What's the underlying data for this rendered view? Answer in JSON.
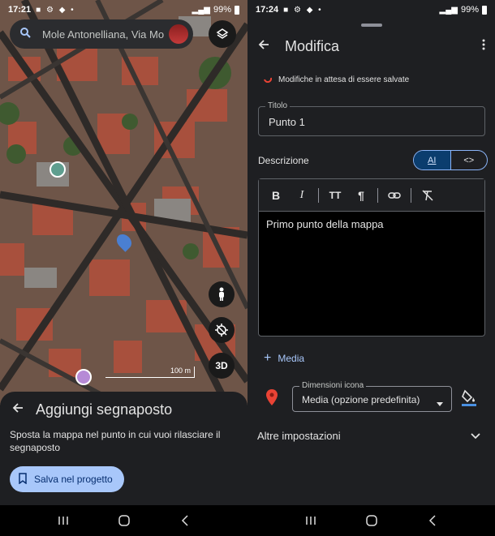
{
  "left": {
    "status": {
      "time": "17:21",
      "battery": "99%"
    },
    "search": {
      "text": "Mole Antonelliana, Via Mo"
    },
    "map": {
      "scale_label": "100 m",
      "mode_3d_label": "3D"
    },
    "sheet": {
      "title": "Aggiungi segnaposto",
      "description": "Sposta la mappa nel punto in cui vuoi rilasciare il segnaposto",
      "save_label": "Salva nel progetto"
    }
  },
  "right": {
    "status": {
      "time": "17:24",
      "battery": "99%"
    },
    "header": {
      "title": "Modifica"
    },
    "pending_text": "Modifiche in attesa di essere salvate",
    "titolo": {
      "label": "Titolo",
      "value": "Punto 1"
    },
    "descrizione_label": "Descrizione",
    "toggle": {
      "rich": "AI",
      "code": "<>"
    },
    "editor": {
      "content": "Primo punto della mappa",
      "bold": "B",
      "italic": "I",
      "textsize": "TT",
      "paragraph": "¶"
    },
    "media_label": "Media",
    "icon_size": {
      "label": "Dimensioni icona",
      "value": "Media (opzione predefinita)"
    },
    "altre_label": "Altre impostazioni"
  },
  "colors": {
    "accent": "#a8c7fa",
    "sheet_bg": "#1e1f22",
    "pin": "#ea4335",
    "button_text": "#062e6f"
  }
}
